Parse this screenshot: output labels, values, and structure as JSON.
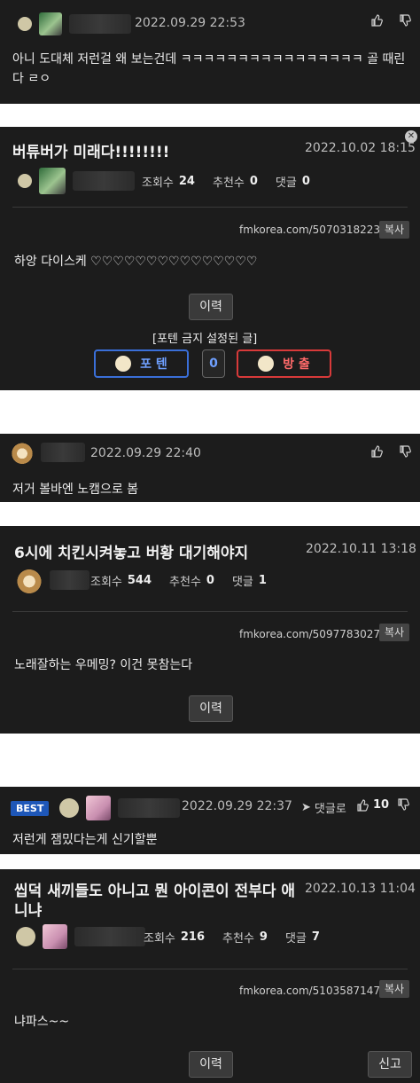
{
  "comment1": {
    "date": "2022.09.29 22:53",
    "text": "아니 도대체 저런걸 왜 보는건데 ㅋㅋㅋㅋㅋㅋㅋㅋㅋㅋㅋㅋㅋㅋㅋㅋ 골 때린다 ㄹㅇ"
  },
  "post1": {
    "title": "버튜버가 미래다!!!!!!!!",
    "date": "2022.10.02 18:15",
    "views_label": "조회수",
    "views": "24",
    "likes_label": "추천수",
    "likes": "0",
    "comments_label": "댓글",
    "comments": "0",
    "url": "fmkorea.com/5070318223",
    "copy_label": "복사",
    "body": "하앙 다이스케 ♡♡♡♡♡♡♡♡♡♡♡♡♡♡♡",
    "history_label": "이력",
    "banned_notice": "[포텐 금지 설정된 글]",
    "poten_label": "포 텐",
    "count": "0",
    "bang_label": "방 출"
  },
  "comment2": {
    "date": "2022.09.29 22:40",
    "text": "저거 볼바엔 노캠으로 봄"
  },
  "post2": {
    "title": "6시에 치킨시켜놓고 버황 대기해야지",
    "date": "2022.10.11 13:18",
    "views_label": "조회수",
    "views": "544",
    "likes_label": "추천수",
    "likes": "0",
    "comments_label": "댓글",
    "comments": "1",
    "url": "fmkorea.com/5097783027",
    "copy_label": "복사",
    "body": "노래잘하는 우메밍? 이건 못참는다",
    "history_label": "이력"
  },
  "comment3": {
    "badge": "BEST",
    "date": "2022.09.29 22:37",
    "reply_label": "댓글로",
    "likes": "10",
    "text": "저런게 잼밌다는게 신기할뿐"
  },
  "post3": {
    "title": "씹덕 새끼들도 아니고 뭔 아이콘이 전부다 애니냐",
    "date": "2022.10.13 11:04",
    "views_label": "조회수",
    "views": "216",
    "likes_label": "추천수",
    "likes": "9",
    "comments_label": "댓글",
    "comments": "7",
    "url": "fmkorea.com/5103587147",
    "copy_label": "복사",
    "body": "냐파스~~",
    "history_label": "이력",
    "report_label": "신고"
  },
  "colors": {
    "card_bg": "#1c1c1c",
    "poten_blue": "#3a6fd8",
    "bang_red": "#d83a3a",
    "best_blue": "#1e57b8"
  }
}
